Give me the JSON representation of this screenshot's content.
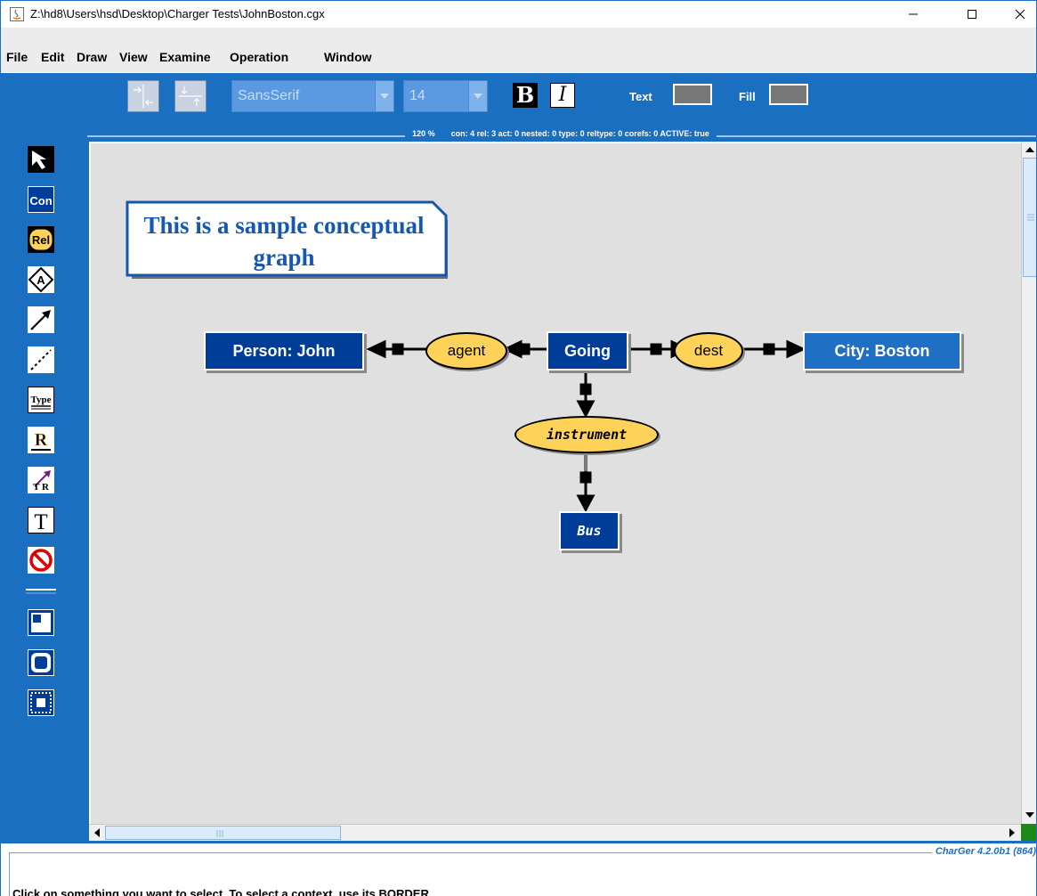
{
  "window": {
    "title": "Z:\\hd8\\Users\\hsd\\Desktop\\Charger Tests\\JohnBoston.cgx",
    "minimize": "—",
    "maximize": "☐",
    "close": "✕"
  },
  "menu": [
    "File",
    "Edit",
    "Draw",
    "View",
    "Examine",
    "Operation",
    "Window"
  ],
  "toolbar": {
    "font_family": "SansSerif",
    "font_size": "14",
    "bold_label": "B",
    "italic_label": "I",
    "text_label": "Text",
    "fill_label": "Fill",
    "text_color": "#787878",
    "fill_color": "#787878"
  },
  "palette": [
    {
      "name": "select-tool",
      "icon": "arrow-cursor-icon",
      "label": ""
    },
    {
      "name": "concept-tool",
      "icon": "concept-icon",
      "label": "Con"
    },
    {
      "name": "relation-tool",
      "icon": "relation-icon",
      "label": "Rel"
    },
    {
      "name": "actor-tool",
      "icon": "actor-icon",
      "label": "A"
    },
    {
      "name": "arrow-tool",
      "icon": "arc-icon",
      "label": ""
    },
    {
      "name": "coref-tool",
      "icon": "coref-dashed-icon",
      "label": ""
    },
    {
      "name": "type-tool",
      "icon": "type-icon",
      "label": "Type"
    },
    {
      "name": "relation-type-tool",
      "icon": "relation-type-icon",
      "label": "R"
    },
    {
      "name": "generalization-tool",
      "icon": "generalization-icon",
      "label": "T R"
    },
    {
      "name": "text-tool",
      "icon": "text-icon",
      "label": "T"
    },
    {
      "name": "delete-tool",
      "icon": "no-icon",
      "label": ""
    },
    {
      "name": "context-tool",
      "icon": "context-icon",
      "label": ""
    },
    {
      "name": "nested-tool",
      "icon": "nested-icon",
      "label": ""
    },
    {
      "name": "cut-context-tool",
      "icon": "cut-context-icon",
      "label": ""
    }
  ],
  "status": {
    "zoom": "120 %",
    "counts": "con: 4  rel: 3  act: 0  nested: 0  type: 0  reltype: 0  corefs: 0  ACTIVE: true"
  },
  "graph": {
    "note_line1": "This is a sample conceptual",
    "note_line2": "graph",
    "concepts": {
      "person": "Person: John",
      "going": "Going",
      "city": "City: Boston",
      "bus": "Bus"
    },
    "relations": {
      "agent": "agent",
      "dest": "dest",
      "instrument": "instrument"
    },
    "colors": {
      "concept": "#003d99",
      "relation": "#ffd25a",
      "canvas": "#e0e0e0"
    }
  },
  "footer": {
    "version": "CharGer 4.2.0b1 (864)",
    "message": "Click on something you want to select. To select a context, use its BORDER."
  }
}
